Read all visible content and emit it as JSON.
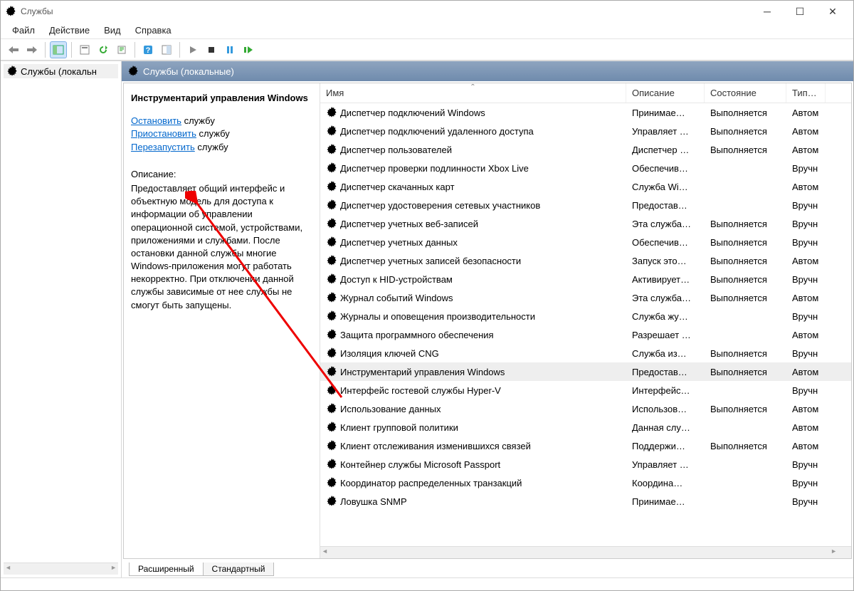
{
  "window": {
    "title": "Службы"
  },
  "menu": {
    "file": "Файл",
    "action": "Действие",
    "view": "Вид",
    "help": "Справка"
  },
  "tree": {
    "root": "Службы (локальн"
  },
  "panel": {
    "header": "Службы (локальные)"
  },
  "detail": {
    "title": "Инструментарий управления Windows",
    "stop_link": "Остановить",
    "stop_suffix": " службу",
    "pause_link": "Приостановить",
    "pause_suffix": " службу",
    "restart_link": "Перезапустить",
    "restart_suffix": " службу",
    "desc_label": "Описание:",
    "description": "Предоставляет общий интерфейс и объектную модель для доступа к информации об управлении операционной системой, устройствами, приложениями и службами. После остановки данной службы многие Windows-приложения могут работать некорректно. При отключении данной службы зависимые от нее службы не смогут быть запущены."
  },
  "columns": {
    "name": "Имя",
    "desc": "Описание",
    "state": "Состояние",
    "type": "Тип за"
  },
  "tabs": {
    "extended": "Расширенный",
    "standard": "Стандартный"
  },
  "services": [
    {
      "name": "Диспетчер подключений Windows",
      "desc": "Принимае…",
      "state": "Выполняется",
      "type": "Автом"
    },
    {
      "name": "Диспетчер подключений удаленного доступа",
      "desc": "Управляет …",
      "state": "Выполняется",
      "type": "Автом"
    },
    {
      "name": "Диспетчер пользователей",
      "desc": "Диспетчер …",
      "state": "Выполняется",
      "type": "Автом"
    },
    {
      "name": "Диспетчер проверки подлинности Xbox Live",
      "desc": "Обеспечив…",
      "state": "",
      "type": "Вручн"
    },
    {
      "name": "Диспетчер скачанных карт",
      "desc": "Служба Wi…",
      "state": "",
      "type": "Автом"
    },
    {
      "name": "Диспетчер удостоверения сетевых участников",
      "desc": "Предостав…",
      "state": "",
      "type": "Вручн"
    },
    {
      "name": "Диспетчер учетных веб-записей",
      "desc": "Эта служба…",
      "state": "Выполняется",
      "type": "Вручн"
    },
    {
      "name": "Диспетчер учетных данных",
      "desc": "Обеспечив…",
      "state": "Выполняется",
      "type": "Вручн"
    },
    {
      "name": "Диспетчер учетных записей безопасности",
      "desc": "Запуск это…",
      "state": "Выполняется",
      "type": "Автом"
    },
    {
      "name": "Доступ к HID-устройствам",
      "desc": "Активирует…",
      "state": "Выполняется",
      "type": "Вручн"
    },
    {
      "name": "Журнал событий Windows",
      "desc": "Эта служба…",
      "state": "Выполняется",
      "type": "Автом"
    },
    {
      "name": "Журналы и оповещения производительности",
      "desc": "Служба жу…",
      "state": "",
      "type": "Вручн"
    },
    {
      "name": "Защита программного обеспечения",
      "desc": "Разрешает …",
      "state": "",
      "type": "Автом"
    },
    {
      "name": "Изоляция ключей CNG",
      "desc": "Служба из…",
      "state": "Выполняется",
      "type": "Вручн"
    },
    {
      "name": "Инструментарий управления Windows",
      "desc": "Предостав…",
      "state": "Выполняется",
      "type": "Автом",
      "selected": true
    },
    {
      "name": "Интерфейс гостевой службы Hyper-V",
      "desc": "Интерфейс…",
      "state": "",
      "type": "Вручн"
    },
    {
      "name": "Использование данных",
      "desc": "Использов…",
      "state": "Выполняется",
      "type": "Автом"
    },
    {
      "name": "Клиент групповой политики",
      "desc": "Данная слу…",
      "state": "",
      "type": "Автом"
    },
    {
      "name": "Клиент отслеживания изменившихся связей",
      "desc": "Поддержи…",
      "state": "Выполняется",
      "type": "Автом"
    },
    {
      "name": "Контейнер службы Microsoft Passport",
      "desc": "Управляет …",
      "state": "",
      "type": "Вручн"
    },
    {
      "name": "Координатор распределенных транзакций",
      "desc": "Координа…",
      "state": "",
      "type": "Вручн"
    },
    {
      "name": "Ловушка SNMP",
      "desc": "Принимае…",
      "state": "",
      "type": "Вручн"
    }
  ]
}
